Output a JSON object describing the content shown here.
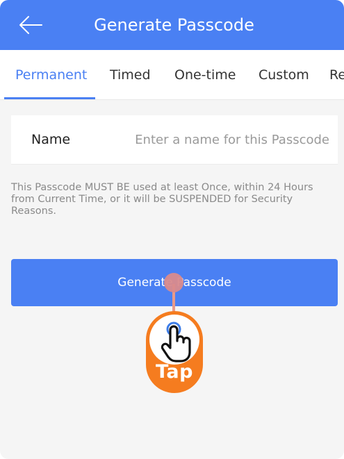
{
  "header": {
    "title": "Generate Passcode",
    "back_icon": "arrow-left-icon"
  },
  "tabs": [
    {
      "label": "Permanent",
      "active": true
    },
    {
      "label": "Timed",
      "active": false
    },
    {
      "label": "One-time",
      "active": false
    },
    {
      "label": "Custom",
      "active": false
    },
    {
      "label": "Re",
      "active": false
    }
  ],
  "form": {
    "name_label": "Name",
    "name_placeholder": "Enter a name for this Passcode",
    "name_value": ""
  },
  "notice": "This Passcode MUST BE used at least Once, within 24 Hours from Current Time, or it will be SUSPENDED for Security Reasons.",
  "actions": {
    "generate_label": "Generate Passcode"
  },
  "tap_hint": {
    "label": "Tap",
    "icon": "hand-pointer-icon"
  },
  "colors": {
    "primary": "#4a80f3",
    "tap_orange": "#f57c1f",
    "tap_line": "#e89a8a"
  }
}
